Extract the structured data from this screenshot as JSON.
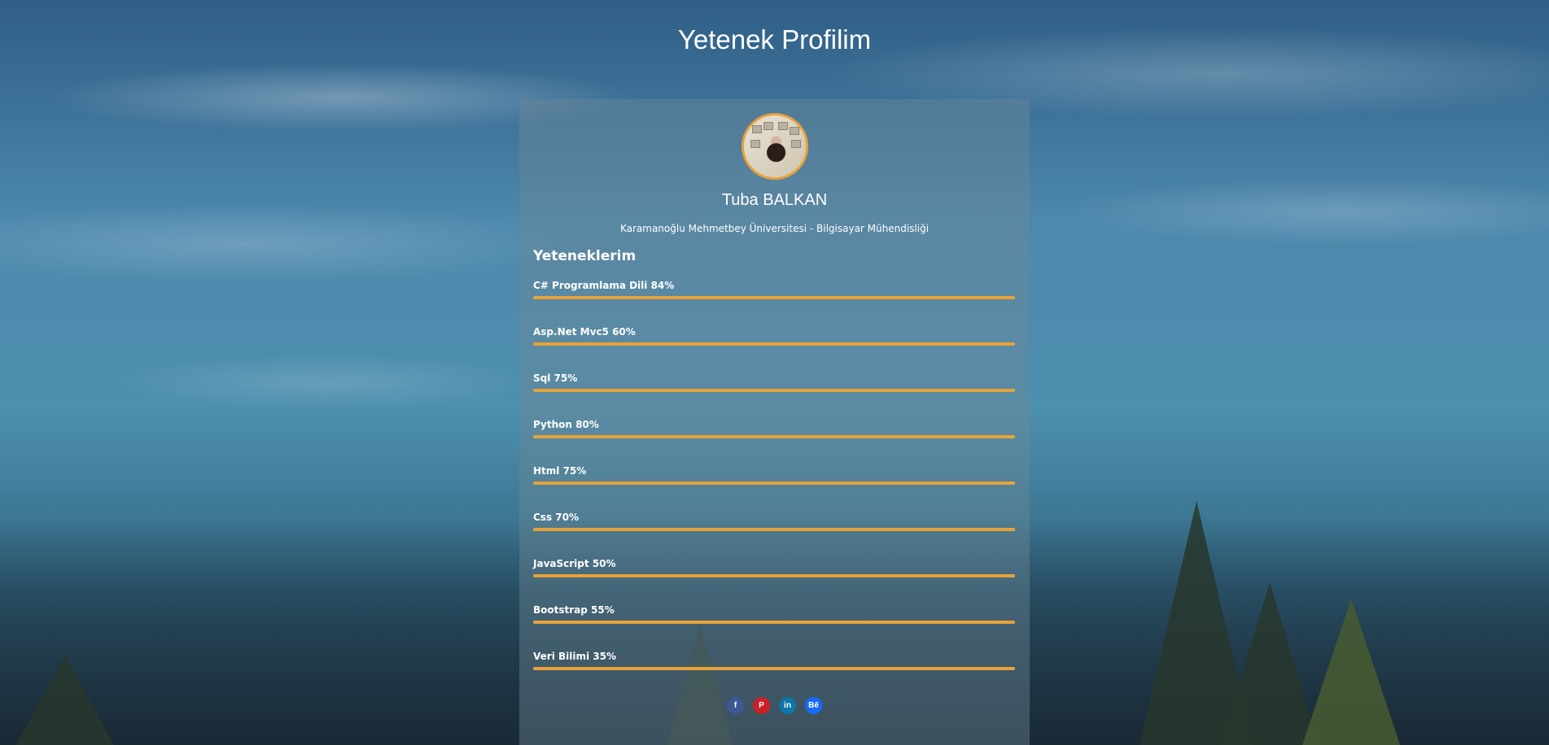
{
  "page": {
    "title": "Yetenek Profilim"
  },
  "profile": {
    "name": "Tuba BALKAN",
    "university": "Karamanoğlu Mehmetbey Üniversitesi - Bilgisayar Mühendisliği"
  },
  "skills_section": {
    "title": "Yeteneklerim",
    "items": [
      {
        "label": "C# Programlama Dili 84%",
        "value": 84
      },
      {
        "label": "Asp.Net Mvc5 60%",
        "value": 60
      },
      {
        "label": "Sql 75%",
        "value": 75
      },
      {
        "label": "Python 80%",
        "value": 80
      },
      {
        "label": "Html 75%",
        "value": 75
      },
      {
        "label": "Css 70%",
        "value": 70
      },
      {
        "label": "JavaScript 50%",
        "value": 50
      },
      {
        "label": "Bootstrap 55%",
        "value": 55
      },
      {
        "label": "Veri Bilimi 35%",
        "value": 35
      }
    ]
  },
  "socials": [
    {
      "name": "facebook-icon",
      "glyph": "f",
      "color": "#3b5998"
    },
    {
      "name": "pinterest-icon",
      "glyph": "P",
      "color": "#cb2027"
    },
    {
      "name": "linkedin-icon",
      "glyph": "in",
      "color": "#0e76a8"
    },
    {
      "name": "behance-icon",
      "glyph": "Bē",
      "color": "#1769ff"
    }
  ],
  "colors": {
    "accent": "#e8a23a",
    "text": "#ffffff"
  }
}
